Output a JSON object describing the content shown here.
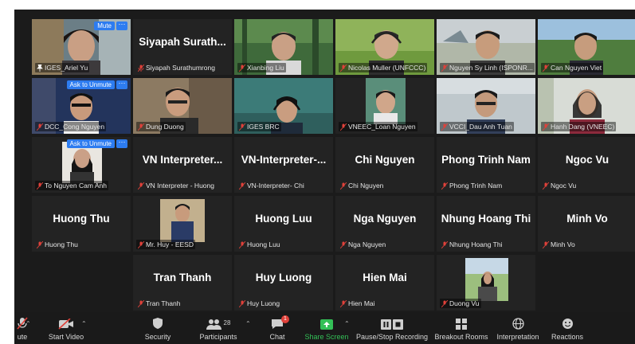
{
  "tiles": [
    {
      "label": "IGES_Ariel Yu",
      "badge": "Mute",
      "dots": "···",
      "pinned": true,
      "active": true
    },
    {
      "name": "Siyapah Surath...",
      "label": "Siyapah Surathumrong"
    },
    {
      "label": "Xianbing Liu"
    },
    {
      "label": "Nicolas Muller (UNFCCC)"
    },
    {
      "label": "Nguyen Sy Linh (ISPONR..."
    },
    {
      "label": "Can Nguyen Viet"
    },
    {
      "label": "DCC_Cong Nguyen",
      "badge": "Ask to Unmute",
      "dots": "···"
    },
    {
      "label": "Dung Duong"
    },
    {
      "label": "IGES BRC"
    },
    {
      "label": "VNEEC_Loan Nguyen"
    },
    {
      "label": "VCCI_Dau Anh Tuan"
    },
    {
      "label": "Hanh Dang (VNEEC)"
    },
    {
      "label": "To Nguyen Cam Anh",
      "badge": "Ask to Unmute",
      "dots": "···"
    },
    {
      "name": "VN  Interpreter...",
      "label": "VN Interpreter - Huong"
    },
    {
      "name": "VN-Interpreter-...",
      "label": "VN-Interpreter- Chi"
    },
    {
      "name": "Chi Nguyen",
      "label": "Chi Nguyen"
    },
    {
      "name": "Phong Trinh Nam",
      "label": "Phong Trinh Nam"
    },
    {
      "name": "Ngoc Vu",
      "label": "Ngoc Vu"
    },
    {
      "name": "Huong Thu",
      "label": "Huong Thu"
    },
    {
      "label": "Mr. Huy - EESD"
    },
    {
      "name": "Huong Luu",
      "label": "Huong Luu"
    },
    {
      "name": "Nga Nguyen",
      "label": "Nga Nguyen"
    },
    {
      "name": "Nhung Hoang Thi",
      "label": "Nhung Hoang Thi"
    },
    {
      "name": "Minh Vo",
      "label": "Minh Vo"
    },
    {
      "name": "Tran Thanh",
      "label": "Tran Thanh"
    },
    {
      "name": "Huy Luong",
      "label": "Huy Luong"
    },
    {
      "name": "Hien Mai",
      "label": "Hien Mai"
    },
    {
      "label": "Duong Vu"
    }
  ],
  "toolbar": {
    "unmute": "ute",
    "start_video": "Start Video",
    "security": "Security",
    "participants": "Participants",
    "participant_count": "28",
    "chat": "Chat",
    "chat_badge": "1",
    "share_screen": "Share Screen",
    "recording": "Pause/Stop Recording",
    "breakout": "Breakout Rooms",
    "interpretation": "Interpretation",
    "reactions": "Reactions"
  },
  "colors": {
    "grid_bg": "#1b1b1b",
    "tile_bg": "#232323",
    "active_border": "#e8e04a",
    "badge_blue": "#2d7cf0",
    "share_green": "#33c057",
    "mic_red": "#e0413a"
  }
}
